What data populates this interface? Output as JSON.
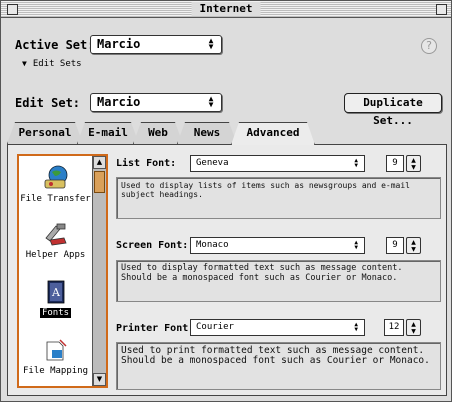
{
  "window": {
    "title": "Internet"
  },
  "active_set": {
    "label": "Active Set:",
    "value": "Marcio"
  },
  "edit_sets_link": "Edit Sets",
  "edit_set": {
    "label": "Edit Set:",
    "value": "Marcio"
  },
  "duplicate_button": "Duplicate Set...",
  "tabs": [
    "Personal",
    "E-mail",
    "Web",
    "News",
    "Advanced"
  ],
  "active_tab": "Advanced",
  "sidebar": {
    "items": [
      {
        "label": "File Transfer",
        "icon": "file-transfer-icon"
      },
      {
        "label": "Helper Apps",
        "icon": "helper-apps-icon"
      },
      {
        "label": "Fonts",
        "icon": "fonts-icon",
        "selected": true
      },
      {
        "label": "File Mapping",
        "icon": "file-mapping-icon"
      }
    ]
  },
  "fonts": {
    "list": {
      "label": "List Font:",
      "value": "Geneva",
      "size": "9",
      "description": "Used to display lists of items such as newsgroups and e-mail subject headings."
    },
    "screen": {
      "label": "Screen Font:",
      "value": "Monaco",
      "size": "9",
      "description": "Used to display formatted text such as message content. Should be a monospaced font such as Courier or Monaco."
    },
    "printer": {
      "label": "Printer Font:",
      "value": "Courier",
      "size": "12",
      "description": "Used to print formatted text such as message content. Should be a monospaced font such as Courier or Monaco."
    }
  },
  "colors": {
    "selection_border": "#d06a1a",
    "window_bg": "#dddddd"
  }
}
